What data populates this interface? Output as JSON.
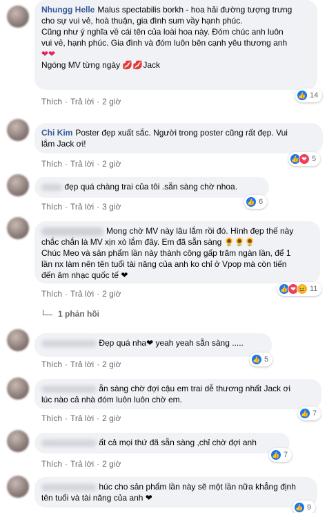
{
  "comments": [
    {
      "name": "Nhungg Helle",
      "lines": [
        "Malus spectabilis borkh - hoa hải đường tượng trưng",
        "cho sự vui vẻ, hoà thuận, gia đình sum vầy hạnh phúc.",
        "Cũng như ý nghĩa về cái tên của loài hoa này. Đóm chúc anh luôn",
        "vui vẻ, hạnh phúc. Gia đình và đóm luôn bên cạnh yêu thương anh",
        "❤❤",
        "Ngóng MV từng ngày 💋💋Jack"
      ],
      "like": "Thích",
      "reply": "Trả lời",
      "time": "2 giờ",
      "reactions": "14"
    },
    {
      "name": "Chi Kim",
      "lines": [
        "Poster đẹp xuất sắc. Người trong poster cũng rất đẹp. Vui",
        "lắm Jack ơi!"
      ],
      "like": "Thích",
      "reply": "Trả lời",
      "time": "2 giờ",
      "reactions": "5"
    },
    {
      "lines": [
        "đẹp quá chàng trai của tôi .sẵn sàng chờ nhoa."
      ],
      "like": "Thích",
      "reply": "Trả lời",
      "time": "3 giờ",
      "reactions": "6"
    },
    {
      "lines": [
        "Mong chờ MV này lâu lắm rồi đó. Hình đẹp thế này",
        "chắc chắn là MV xịn xò lắm đây. Em đã sẵn sàng 🌻🌻🌻",
        "Chúc Meo và sản phẩm lần này thành công gấp trăm ngàn lần, để 1",
        "lần nx làm nên tên tuổi tài năng của anh ko chỉ ở Vpop mà còn tiến",
        "đến âm nhạc quốc tế ❤"
      ],
      "like": "Thích",
      "reply": "Trả lời",
      "time": "2 giờ",
      "reactions": "11"
    },
    {
      "lines": [
        "Đẹp quá nha❤ yeah yeah sẵn sàng ....."
      ],
      "like": "Thích",
      "reply": "Trả lời",
      "time": "2 giờ",
      "reactions": "5"
    },
    {
      "lines": [
        "ẵn sàng chờ đợi cậu em trai dễ thương nhất Jack ơi",
        "lúc nào cả nhà đóm luôn luôn chờ em."
      ],
      "like": "Thích",
      "reply": "Trả lời",
      "time": "2 giờ",
      "reactions": "7"
    },
    {
      "lines": [
        "ất cả mọi thứ đã sẵn sàng ,chỉ chờ đợi anh"
      ],
      "like": "Thích",
      "reply": "Trả lời",
      "time": "2 giờ",
      "reactions": "7"
    },
    {
      "lines": [
        "húc cho sản phẩm lần này sẽ một lần nữa khẳng định",
        "tên tuổi và tài năng của anh ❤"
      ],
      "reactions": "9"
    }
  ],
  "replies_link": "1 phản hồi"
}
